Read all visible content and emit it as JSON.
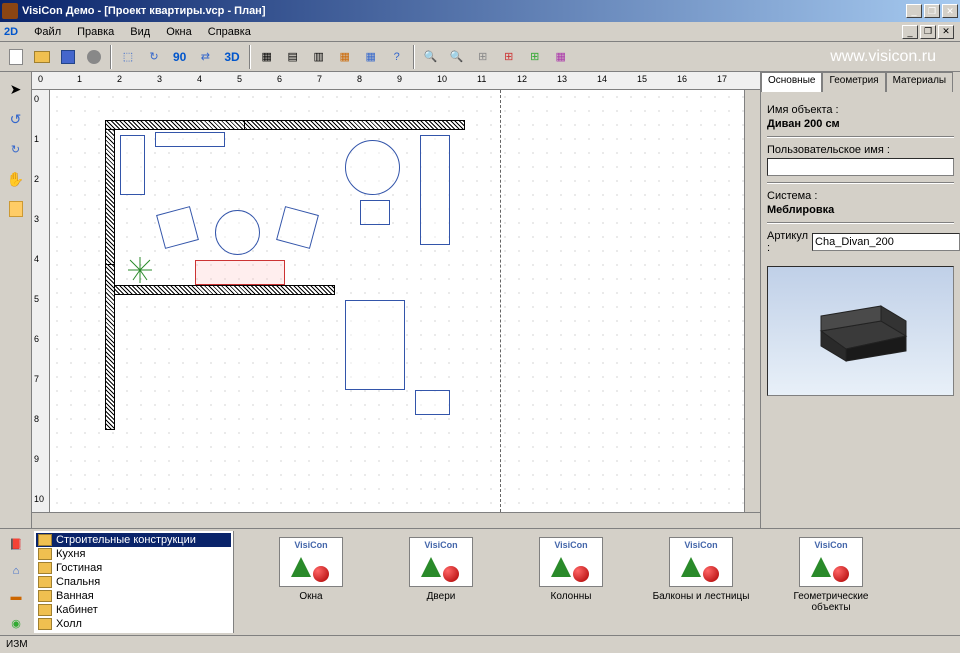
{
  "titlebar": {
    "title": "VisiCon Демо - [Проект квартиры.vcp - План]"
  },
  "menubar": {
    "mode": "2D",
    "items": [
      "Файл",
      "Правка",
      "Вид",
      "Окна",
      "Справка"
    ]
  },
  "url_watermark": "www.visicon.ru",
  "toolbar": {
    "mode3d": "3D",
    "rotate_label": "90"
  },
  "right_panel": {
    "tabs": [
      "Основные",
      "Геометрия",
      "Материалы"
    ],
    "object_name_label": "Имя объекта :",
    "object_name_value": "Диван 200 см",
    "user_name_label": "Пользовательское имя :",
    "user_name_value": "",
    "system_label": "Система :",
    "system_value": "Меблировка",
    "article_label": "Артикул :",
    "article_value": "Cha_Divan_200"
  },
  "tree": {
    "items": [
      "Строительные конструкции",
      "Кухня",
      "Гостиная",
      "Спальня",
      "Ванная",
      "Кабинет",
      "Холл"
    ]
  },
  "library": {
    "brand": "VisiCon",
    "items": [
      "Окна",
      "Двери",
      "Колонны",
      "Балконы и лестницы",
      "Геометрические объекты"
    ]
  },
  "statusbar": {
    "text": "ИЗМ"
  },
  "ruler_h_ticks": [
    "0",
    "1",
    "2",
    "3",
    "4",
    "5",
    "6",
    "7",
    "8",
    "9",
    "10",
    "11",
    "12",
    "13",
    "14",
    "15",
    "16",
    "17"
  ],
  "ruler_v_ticks": [
    "0",
    "1",
    "2",
    "3",
    "4",
    "5",
    "6",
    "7",
    "8",
    "9",
    "10"
  ]
}
